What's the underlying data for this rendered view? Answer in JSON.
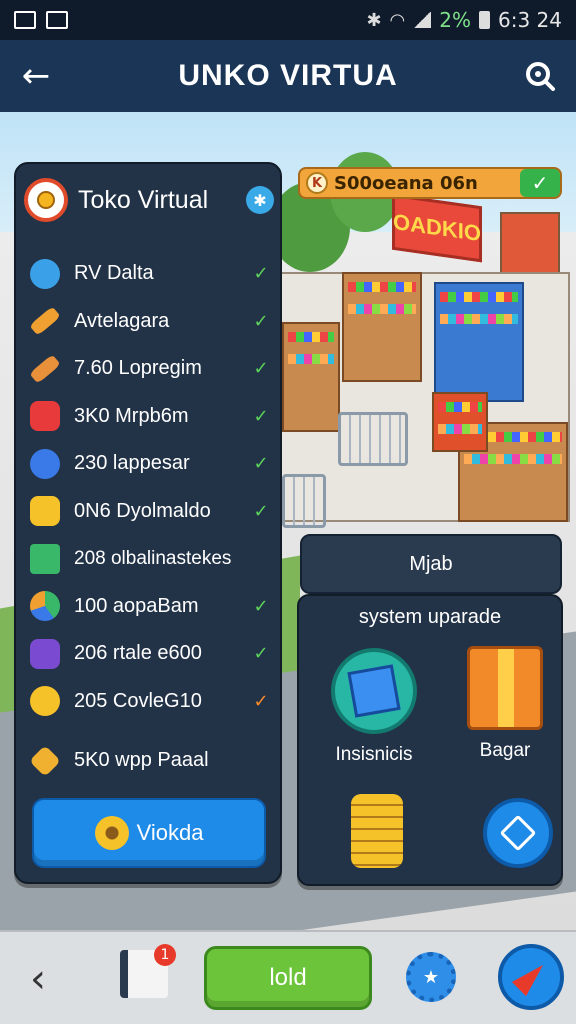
{
  "status_bar": {
    "battery": "2%",
    "time": "6:3 24"
  },
  "header": {
    "title": "UNKO VIRTUA"
  },
  "coin_bar": {
    "text": "S00oeana 06n"
  },
  "shop_sign": "OADKIO",
  "store_panel": {
    "title": "Toko Virtual",
    "items": [
      {
        "label": "RV Dalta",
        "checked": true,
        "check_color": "#5cd35a"
      },
      {
        "label": "Avtelagara",
        "checked": true,
        "check_color": "#5cd35a"
      },
      {
        "label": "7.60 Lopregim",
        "checked": true,
        "check_color": "#5cd35a"
      },
      {
        "label": "3K0 Mrpb6m",
        "checked": true,
        "check_color": "#5cd35a"
      },
      {
        "label": "230 lappesar",
        "checked": true,
        "check_color": "#5cd35a"
      },
      {
        "label": "0N6 Dyolmaldo",
        "checked": true,
        "check_color": "#5cd35a"
      },
      {
        "label": "208 olbalinastekes",
        "checked": false
      },
      {
        "label": "100 aopaBam",
        "checked": true,
        "check_color": "#5cd35a"
      },
      {
        "label": "206 rtale e600",
        "checked": true,
        "check_color": "#5cd35a"
      },
      {
        "label": "205 CovleG10",
        "checked": true,
        "check_color": "#ff8a2a"
      },
      {
        "label": "5K0 wpp Paaal",
        "checked": false
      }
    ],
    "button_label": "Viokda"
  },
  "mini_panel": {
    "label": "Mjab"
  },
  "upgrade_panel": {
    "title": "system uparade",
    "tiles": [
      {
        "label": "Insisnicis"
      },
      {
        "label": "Bagar"
      }
    ]
  },
  "bottom_bar": {
    "notification_count": "1",
    "main_button": "lold"
  },
  "colors": {
    "header_bg": "#1b3556",
    "panel_bg": "#223247",
    "accent_blue": "#1f8be8",
    "accent_green": "#6cc43a",
    "coin_orange": "#f2a53a"
  }
}
